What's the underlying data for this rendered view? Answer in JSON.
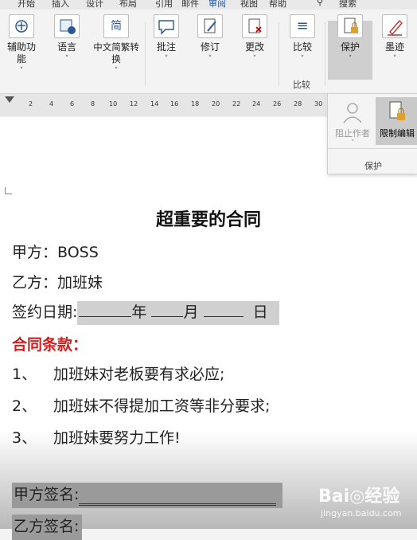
{
  "tabs": [
    "开始",
    "插入",
    "设计",
    "布局",
    "引用",
    "邮件",
    "审阅",
    "视图",
    "帮助",
    "搜索"
  ],
  "active_tab": "审阅",
  "ribbon": {
    "buttons": [
      {
        "label": "辅助功能",
        "caret": "˅"
      },
      {
        "label": "语言",
        "caret": "˅"
      },
      {
        "label": "中文简繁转换",
        "caret": "˅"
      },
      {
        "label": "批注",
        "caret": "˅"
      },
      {
        "label": "修订",
        "caret": "˅"
      },
      {
        "label": "更改",
        "caret": "˅"
      },
      {
        "label": "比较",
        "caret": "˅"
      },
      {
        "label": "保护",
        "caret": "˅"
      },
      {
        "label": "墨迹",
        "caret": "˅"
      }
    ],
    "compare_group": "比较",
    "icon_glyphs": {
      "convert": "简",
      "compare": "≡"
    }
  },
  "ruler": {
    "ticks": [
      "2",
      "4",
      "6",
      "8",
      "10",
      "12",
      "14",
      "16",
      "18",
      "20",
      "22",
      "24",
      "26",
      "28",
      "30"
    ]
  },
  "protect_popup": {
    "block_authors": "阻止作者",
    "restrict_editing": "限制编辑",
    "group_label": "保护"
  },
  "document": {
    "title": "超重要的合同",
    "party_a": "甲方：BOSS",
    "party_b": "乙方：加班妹",
    "sign_date_label": "签约日期:",
    "year": "年",
    "month": "月",
    "day": "日",
    "terms_heading": "合同条款：",
    "terms": [
      {
        "num": "1、",
        "text": "加班妹对老板要有求必应;"
      },
      {
        "num": "2、",
        "text": "加班妹不得提加工资等非分要求;"
      },
      {
        "num": "3、",
        "text": "加班妹要努力工作!"
      }
    ],
    "sign_a": "甲方签名:",
    "sign_b": "乙方签名:"
  },
  "watermark": {
    "brand": "Bai◎经验",
    "url": "jingyan.baidu.com"
  }
}
